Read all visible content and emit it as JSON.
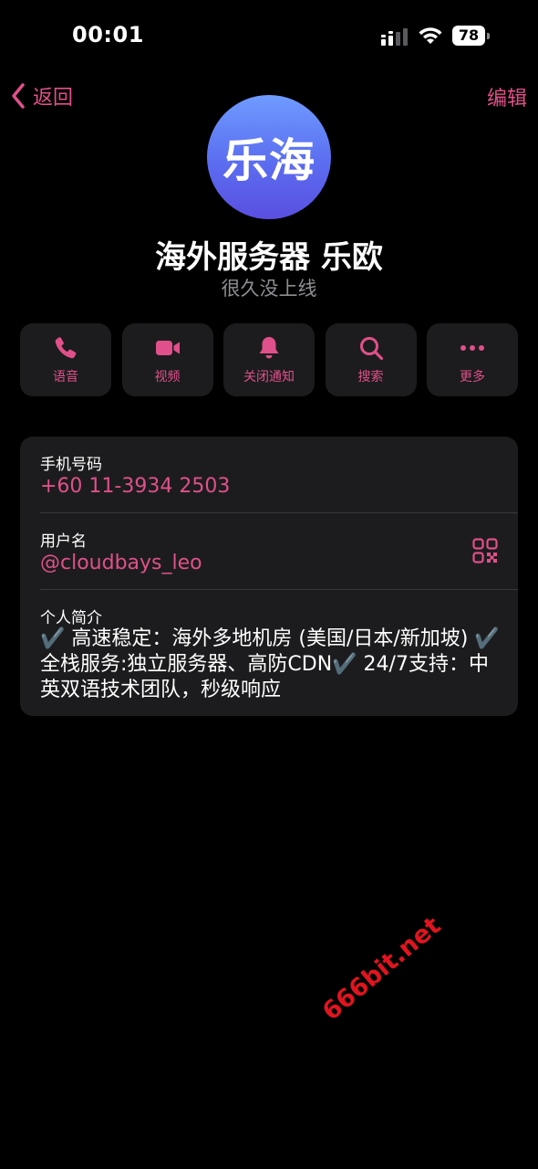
{
  "status_bar": {
    "time": "00:01",
    "battery": "78"
  },
  "nav": {
    "back_label": "返回",
    "edit_label": "编辑"
  },
  "profile": {
    "avatar_text": "乐海",
    "name": "海外服务器 乐欧",
    "status": "很久没上线"
  },
  "actions": [
    {
      "label": "语音",
      "icon": "phone-icon"
    },
    {
      "label": "视频",
      "icon": "video-camera-icon"
    },
    {
      "label": "关闭通知",
      "icon": "bell-icon"
    },
    {
      "label": "搜索",
      "icon": "search-icon"
    },
    {
      "label": "更多",
      "icon": "more-dots-icon"
    }
  ],
  "info": {
    "phone_label": "手机号码",
    "phone_value": "+60 11-3934 2503",
    "username_label": "用户名",
    "username_value": "@cloudbays_leo",
    "bio_label": "个人简介",
    "bio_text": "✔️ 高速稳定：海外多地机房 (美国/日本/新加坡) ✔️ 全栈服务:独立服务器、高防CDN✔️ 24/7支持：中英双语技术团队，秒级响应"
  },
  "watermark": "666bit.net",
  "colors": {
    "accent": "#e0508a",
    "card": "#1c1c1e",
    "secondary_text": "#8e8e93",
    "watermark": "#e0141f"
  }
}
